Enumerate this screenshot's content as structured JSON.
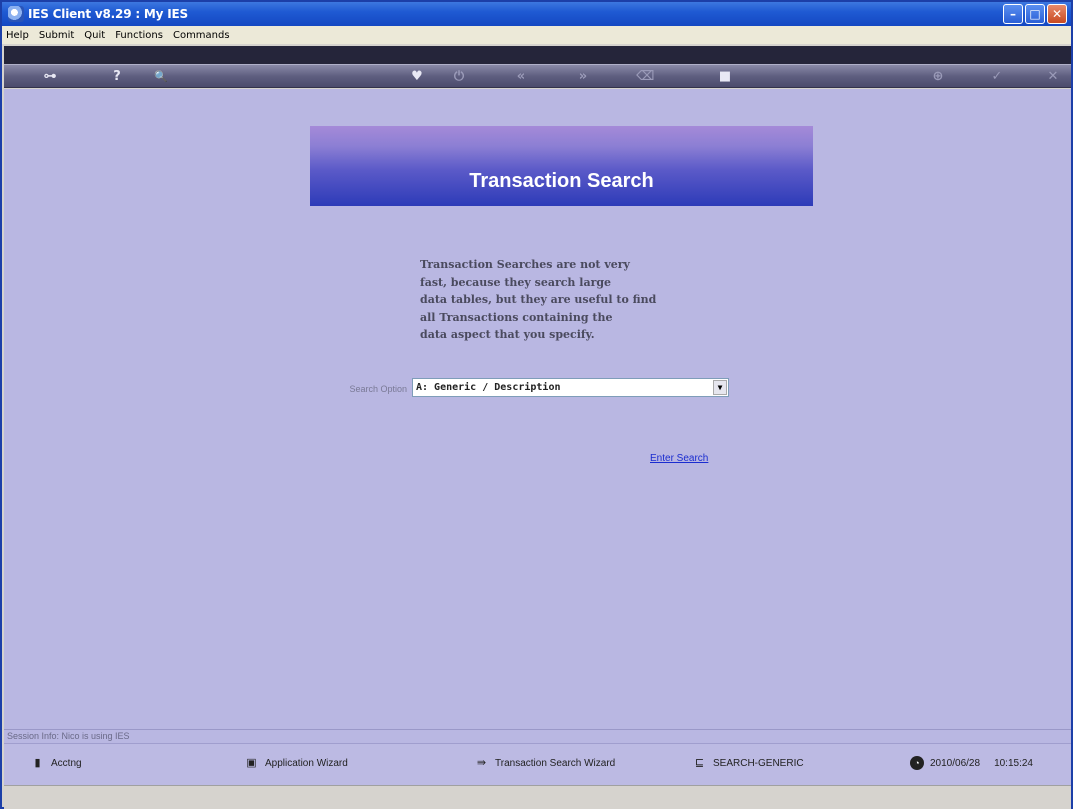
{
  "window": {
    "title": "IES Client v8.29 : My IES",
    "controls": {
      "minimize": "–",
      "maximize": "□",
      "close": "✕"
    }
  },
  "menubar": {
    "items": [
      "Help",
      "Submit",
      "Quit",
      "Functions",
      "Commands"
    ]
  },
  "toolbar": {
    "icons": [
      {
        "name": "key-icon",
        "glyph": "⊶"
      },
      {
        "name": "help-icon",
        "glyph": "?"
      },
      {
        "name": "search-icon",
        "glyph": "🔍"
      },
      {
        "name": "heart-icon",
        "glyph": "♥"
      },
      {
        "name": "power-icon",
        "glyph": "⏻"
      },
      {
        "name": "rewind-icon",
        "glyph": "«"
      },
      {
        "name": "forward-icon",
        "glyph": "»"
      },
      {
        "name": "trash-icon",
        "glyph": "⌫"
      },
      {
        "name": "stop-icon",
        "glyph": "■"
      },
      {
        "name": "save-icon",
        "glyph": "⊕"
      },
      {
        "name": "check-icon",
        "glyph": "✓"
      },
      {
        "name": "close-icon",
        "glyph": "✕"
      }
    ]
  },
  "main": {
    "banner_title": "Transaction Search",
    "info_lines": [
      "Transaction Searches are not very",
      "fast, because they search large",
      "data tables, but they are useful to find",
      "all Transactions containing the",
      "data aspect that you specify."
    ],
    "search_option_label": "Search Option",
    "search_option_value": "A: Generic / Description",
    "enter_search": "Enter Search"
  },
  "session": {
    "text": "Session Info: Nico is using IES"
  },
  "taskbar": {
    "acctng": "Acctng",
    "app_wizard": "Application Wizard",
    "txn_wizard": "Transaction Search Wizard",
    "search_generic": "SEARCH-GENERIC",
    "date": "2010/06/28",
    "time": "10:15:24"
  },
  "colors": {
    "main_bg": "#b9b7e2",
    "banner_top": "#a58ad8",
    "banner_bottom": "#2d3bb8",
    "link": "#1a2cd0"
  }
}
